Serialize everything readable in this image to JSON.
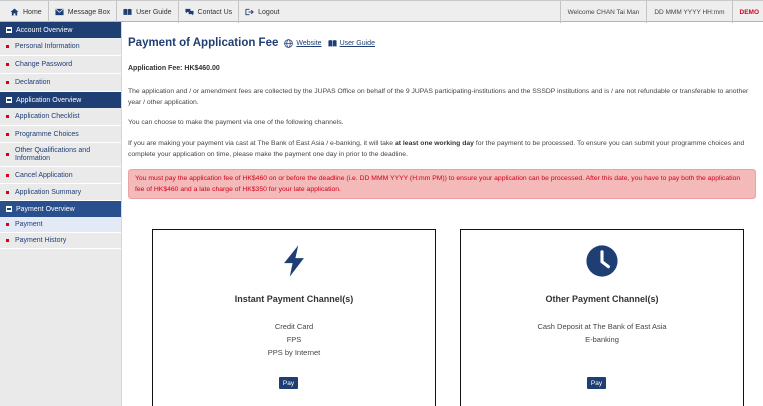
{
  "topnav": {
    "items": [
      {
        "label": "Home",
        "icon": "home-icon"
      },
      {
        "label": "Message Box",
        "icon": "message-icon"
      },
      {
        "label": "User Guide",
        "icon": "book-icon"
      },
      {
        "label": "Contact Us",
        "icon": "chat-icon"
      },
      {
        "label": "Logout",
        "icon": "logout-icon"
      }
    ],
    "welcome": "Welcome CHAN Tai Man",
    "datetime": "DD MMM YYYY HH:mm",
    "demo": "DEMO"
  },
  "sidebar": {
    "account_overview": "Account Overview",
    "account_items": [
      "Personal Information",
      "Change Password",
      "Declaration"
    ],
    "application_overview": "Application Overview",
    "application_items": [
      "Application Checklist",
      "Programme Choices",
      "Other Qualifications and Information",
      "Cancel Application",
      "Application Summary"
    ],
    "payment_overview": "Payment Overview",
    "payment_items": [
      "Payment",
      "Payment History"
    ]
  },
  "main": {
    "title": "Payment of Application Fee",
    "website_link": "Website",
    "user_guide_link": "User Guide",
    "fee_line": "Application Fee: HK$460.00",
    "para1": "The application and / or amendment fees are collected by the JUPAS Office on behalf of the 9 JUPAS participating-institutions and the SSSDP institutions and is / are not refundable or transferable to another year / other application.",
    "para2": "You can choose to make the payment via one of the following channels.",
    "para3_before": "If you are making your payment via cast at The Bank of East Asia / e-banking, it will take ",
    "para3_bold": "at least one working day",
    "para3_after": " for the payment to be processed. To ensure you can submit your programme choices and complete your application on time, please make the payment one day in prior to the deadline.",
    "alert": "You must pay the application fee of HK$460 on or before the deadline (i.e. DD MMM YYYY (H:mm PM)) to ensure your application can be processed. After this date, you have to pay both the application fee of HK$460 and a late charge of HK$350 for your late application."
  },
  "cards": {
    "instant": {
      "title": "Instant Payment Channel(s)",
      "icon": "lightning-icon",
      "lines": [
        "Credit Card",
        "FPS",
        "PPS by Internet"
      ],
      "button": "Pay"
    },
    "other": {
      "title": "Other Payment Channel(s)",
      "icon": "clock-icon",
      "lines": [
        "Cash Deposit at The Bank of East Asia",
        "E-banking"
      ],
      "button": "Pay"
    }
  },
  "colors": {
    "navy": "#1f3e74",
    "alert_bg": "#f4b9b9",
    "alert_text": "#d0021b",
    "sidebar_bg": "#eaeaea"
  }
}
